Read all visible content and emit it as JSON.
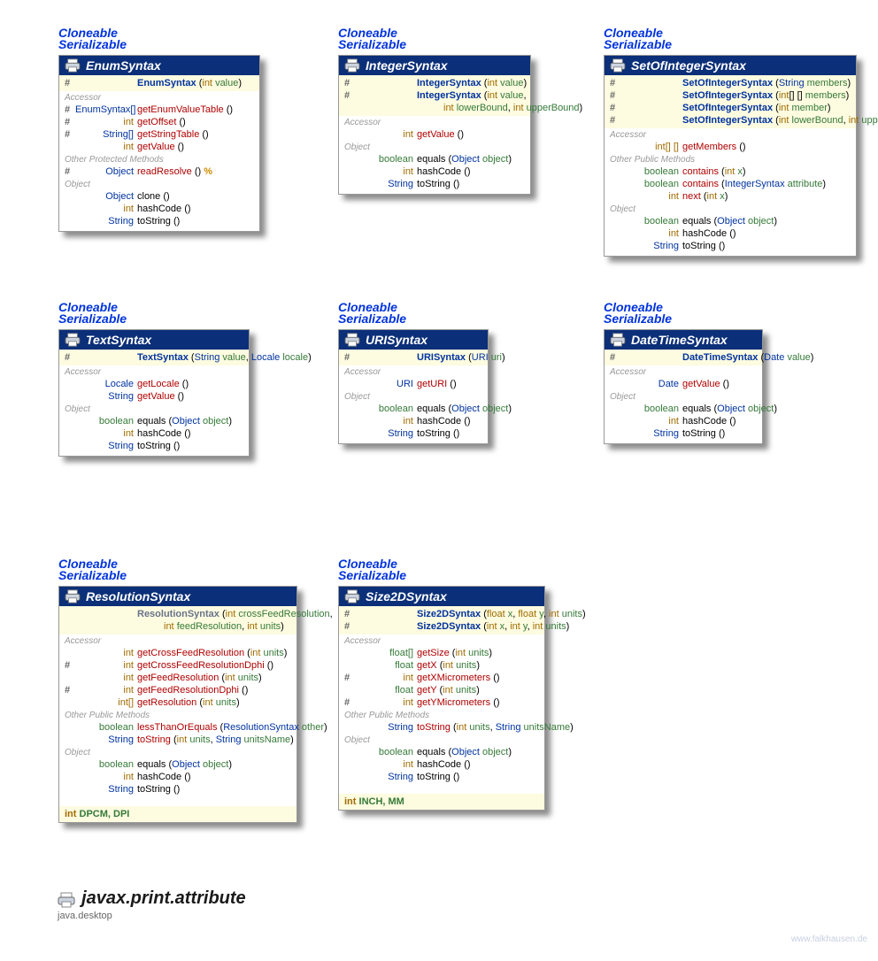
{
  "implements": {
    "cloneable": "Cloneable",
    "serializable": "Serializable"
  },
  "package": {
    "name": "javax.print.attribute",
    "module": "java.desktop"
  },
  "watermark": "www.falkhausen.de",
  "cards": {
    "enum": {
      "title": "EnumSyntax",
      "ctors": [
        {
          "vis": "#",
          "name": "EnumSyntax",
          "params": "(int value)"
        }
      ],
      "accessor": [
        {
          "vis": "#",
          "rt": "EnumSyntax[]",
          "rtc": "param-type",
          "name": "getEnumValueTable",
          "params": "()"
        },
        {
          "vis": "#",
          "rt": "int",
          "rtc": "kw-int",
          "name": "getOffset",
          "params": "()"
        },
        {
          "vis": "#",
          "rt": "String[]",
          "rtc": "kw-str",
          "name": "getStringTable",
          "params": "()"
        },
        {
          "vis": "",
          "rt": "int",
          "rtc": "kw-int",
          "name": "getValue",
          "params": "()"
        }
      ],
      "otherProtected": [
        {
          "vis": "#",
          "rt": "Object",
          "rtc": "kw-obj",
          "name": "readResolve",
          "params": "() ",
          "suffix": "%"
        }
      ],
      "object": [
        {
          "vis": "",
          "rt": "Object",
          "rtc": "kw-obj",
          "name": "clone",
          "nameC": "",
          "params": "()"
        },
        {
          "vis": "",
          "rt": "int",
          "rtc": "kw-int",
          "name": "hashCode",
          "nameC": "",
          "params": "()"
        },
        {
          "vis": "",
          "rt": "String",
          "rtc": "kw-str",
          "name": "toString",
          "nameC": "",
          "params": "()"
        }
      ],
      "sect": {
        "accessor": "Accessor",
        "otherProtected": "Other Protected Methods",
        "object": "Object"
      }
    },
    "integer": {
      "title": "IntegerSyntax",
      "ctors": [
        {
          "vis": "#",
          "name": "IntegerSyntax",
          "params": "(int value)"
        },
        {
          "vis": "#",
          "name": "IntegerSyntax",
          "params": "(int value,",
          "params2": "int lowerBound, int upperBound)"
        }
      ],
      "accessor": [
        {
          "vis": "",
          "rt": "int",
          "rtc": "kw-int",
          "name": "getValue",
          "params": "()"
        }
      ],
      "object": [
        {
          "vis": "",
          "rt": "boolean",
          "rtc": "kw-bool",
          "name": "equals",
          "nameC": "",
          "params": "(Object object)"
        },
        {
          "vis": "",
          "rt": "int",
          "rtc": "kw-int",
          "name": "hashCode",
          "nameC": "",
          "params": "()"
        },
        {
          "vis": "",
          "rt": "String",
          "rtc": "kw-str",
          "name": "toString",
          "nameC": "",
          "params": "()"
        }
      ],
      "sect": {
        "accessor": "Accessor",
        "object": "Object"
      }
    },
    "setint": {
      "title": "SetOfIntegerSyntax",
      "ctors": [
        {
          "vis": "#",
          "name": "SetOfIntegerSyntax",
          "params": "(String members)"
        },
        {
          "vis": "#",
          "name": "SetOfIntegerSyntax",
          "params": "(int[] [] members)"
        },
        {
          "vis": "#",
          "name": "SetOfIntegerSyntax",
          "params": "(int member)"
        },
        {
          "vis": "#",
          "name": "SetOfIntegerSyntax",
          "params": "(int lowerBound, int upperBound)"
        }
      ],
      "accessor": [
        {
          "vis": "",
          "rt": "int[] []",
          "rtc": "kw-int",
          "name": "getMembers",
          "params": "()"
        }
      ],
      "otherPublic": [
        {
          "vis": "",
          "rt": "boolean",
          "rtc": "kw-bool",
          "name": "contains",
          "params": "(int x)"
        },
        {
          "vis": "",
          "rt": "boolean",
          "rtc": "kw-bool",
          "name": "contains",
          "params": "(IntegerSyntax attribute)"
        },
        {
          "vis": "",
          "rt": "int",
          "rtc": "kw-int",
          "name": "next",
          "params": "(int x)"
        }
      ],
      "object": [
        {
          "vis": "",
          "rt": "boolean",
          "rtc": "kw-bool",
          "name": "equals",
          "nameC": "",
          "params": "(Object object)"
        },
        {
          "vis": "",
          "rt": "int",
          "rtc": "kw-int",
          "name": "hashCode",
          "nameC": "",
          "params": "()"
        },
        {
          "vis": "",
          "rt": "String",
          "rtc": "kw-str",
          "name": "toString",
          "nameC": "",
          "params": "()"
        }
      ],
      "sect": {
        "accessor": "Accessor",
        "otherPublic": "Other Public Methods",
        "object": "Object"
      }
    },
    "text": {
      "title": "TextSyntax",
      "ctors": [
        {
          "vis": "#",
          "name": "TextSyntax",
          "params": "(String value, Locale locale)"
        }
      ],
      "accessor": [
        {
          "vis": "",
          "rt": "Locale",
          "rtc": "kw-obj",
          "name": "getLocale",
          "params": "()"
        },
        {
          "vis": "",
          "rt": "String",
          "rtc": "kw-str",
          "name": "getValue",
          "params": "()"
        }
      ],
      "object": [
        {
          "vis": "",
          "rt": "boolean",
          "rtc": "kw-bool",
          "name": "equals",
          "nameC": "",
          "params": "(Object object)"
        },
        {
          "vis": "",
          "rt": "int",
          "rtc": "kw-int",
          "name": "hashCode",
          "nameC": "",
          "params": "()"
        },
        {
          "vis": "",
          "rt": "String",
          "rtc": "kw-str",
          "name": "toString",
          "nameC": "",
          "params": "()"
        }
      ],
      "sect": {
        "accessor": "Accessor",
        "object": "Object"
      }
    },
    "uri": {
      "title": "URISyntax",
      "ctors": [
        {
          "vis": "#",
          "name": "URISyntax",
          "params": "(URI uri)"
        }
      ],
      "accessor": [
        {
          "vis": "",
          "rt": "URI",
          "rtc": "kw-obj",
          "name": "getURI",
          "params": "()"
        }
      ],
      "object": [
        {
          "vis": "",
          "rt": "boolean",
          "rtc": "kw-bool",
          "name": "equals",
          "nameC": "",
          "params": "(Object object)"
        },
        {
          "vis": "",
          "rt": "int",
          "rtc": "kw-int",
          "name": "hashCode",
          "nameC": "",
          "params": "()"
        },
        {
          "vis": "",
          "rt": "String",
          "rtc": "kw-str",
          "name": "toString",
          "nameC": "",
          "params": "()"
        }
      ],
      "sect": {
        "accessor": "Accessor",
        "object": "Object"
      }
    },
    "datetime": {
      "title": "DateTimeSyntax",
      "ctors": [
        {
          "vis": "#",
          "name": "DateTimeSyntax",
          "params": "(Date value)"
        }
      ],
      "accessor": [
        {
          "vis": "",
          "rt": "Date",
          "rtc": "kw-obj",
          "name": "getValue",
          "params": "()"
        }
      ],
      "object": [
        {
          "vis": "",
          "rt": "boolean",
          "rtc": "kw-bool",
          "name": "equals",
          "nameC": "",
          "params": "(Object object)"
        },
        {
          "vis": "",
          "rt": "int",
          "rtc": "kw-int",
          "name": "hashCode",
          "nameC": "",
          "params": "()"
        },
        {
          "vis": "",
          "rt": "String",
          "rtc": "kw-str",
          "name": "toString",
          "nameC": "",
          "params": "()"
        }
      ],
      "sect": {
        "accessor": "Accessor",
        "object": "Object"
      }
    },
    "resolution": {
      "title": "ResolutionSyntax",
      "ctors": [
        {
          "vis": "",
          "name": "ResolutionSyntax",
          "params": "(int crossFeedResolution,",
          "params2": "int feedResolution, int units)"
        }
      ],
      "accessor": [
        {
          "vis": "",
          "rt": "int",
          "rtc": "kw-int",
          "name": "getCrossFeedResolution",
          "params": "(int units)"
        },
        {
          "vis": "#",
          "rt": "int",
          "rtc": "kw-int",
          "name": "getCrossFeedResolutionDphi",
          "params": "()"
        },
        {
          "vis": "",
          "rt": "int",
          "rtc": "kw-int",
          "name": "getFeedResolution",
          "params": "(int units)"
        },
        {
          "vis": "#",
          "rt": "int",
          "rtc": "kw-int",
          "name": "getFeedResolutionDphi",
          "params": "()"
        },
        {
          "vis": "",
          "rt": "int[]",
          "rtc": "kw-int",
          "name": "getResolution",
          "params": "(int units)"
        }
      ],
      "otherPublic": [
        {
          "vis": "",
          "rt": "boolean",
          "rtc": "kw-bool",
          "name": "lessThanOrEquals",
          "params": "(ResolutionSyntax other)"
        },
        {
          "vis": "",
          "rt": "String",
          "rtc": "kw-str",
          "name": "toString",
          "params": "(int units, String unitsName)"
        }
      ],
      "object": [
        {
          "vis": "",
          "rt": "boolean",
          "rtc": "kw-bool",
          "name": "equals",
          "nameC": "",
          "params": "(Object object)"
        },
        {
          "vis": "",
          "rt": "int",
          "rtc": "kw-int",
          "name": "hashCode",
          "nameC": "",
          "params": "()"
        },
        {
          "vis": "",
          "rt": "String",
          "rtc": "kw-str",
          "name": "toString",
          "nameC": "",
          "params": "()"
        }
      ],
      "constants": "int DPCM, DPI",
      "sect": {
        "accessor": "Accessor",
        "otherPublic": "Other Public Methods",
        "object": "Object"
      }
    },
    "size2d": {
      "title": "Size2DSyntax",
      "ctors": [
        {
          "vis": "#",
          "name": "Size2DSyntax",
          "params": "(float x, float y, int units)"
        },
        {
          "vis": "#",
          "name": "Size2DSyntax",
          "params": "(int x, int y, int units)"
        }
      ],
      "accessor": [
        {
          "vis": "",
          "rt": "float[]",
          "rtc": "kw-float",
          "name": "getSize",
          "params": "(int units)"
        },
        {
          "vis": "",
          "rt": "float",
          "rtc": "kw-float",
          "name": "getX",
          "params": "(int units)"
        },
        {
          "vis": "#",
          "rt": "int",
          "rtc": "kw-int",
          "name": "getXMicrometers",
          "params": "()"
        },
        {
          "vis": "",
          "rt": "float",
          "rtc": "kw-float",
          "name": "getY",
          "params": "(int units)"
        },
        {
          "vis": "#",
          "rt": "int",
          "rtc": "kw-int",
          "name": "getYMicrometers",
          "params": "()"
        }
      ],
      "otherPublic": [
        {
          "vis": "",
          "rt": "String",
          "rtc": "kw-str",
          "name": "toString",
          "params": "(int units, String unitsName)"
        }
      ],
      "object": [
        {
          "vis": "",
          "rt": "boolean",
          "rtc": "kw-bool",
          "name": "equals",
          "nameC": "",
          "params": "(Object object)"
        },
        {
          "vis": "",
          "rt": "int",
          "rtc": "kw-int",
          "name": "hashCode",
          "nameC": "",
          "params": "()"
        },
        {
          "vis": "",
          "rt": "String",
          "rtc": "kw-str",
          "name": "toString",
          "nameC": "",
          "params": "()"
        }
      ],
      "constants": "int INCH, MM",
      "sect": {
        "accessor": "Accessor",
        "otherPublic": "Other Public Methods",
        "object": "Object"
      }
    }
  }
}
